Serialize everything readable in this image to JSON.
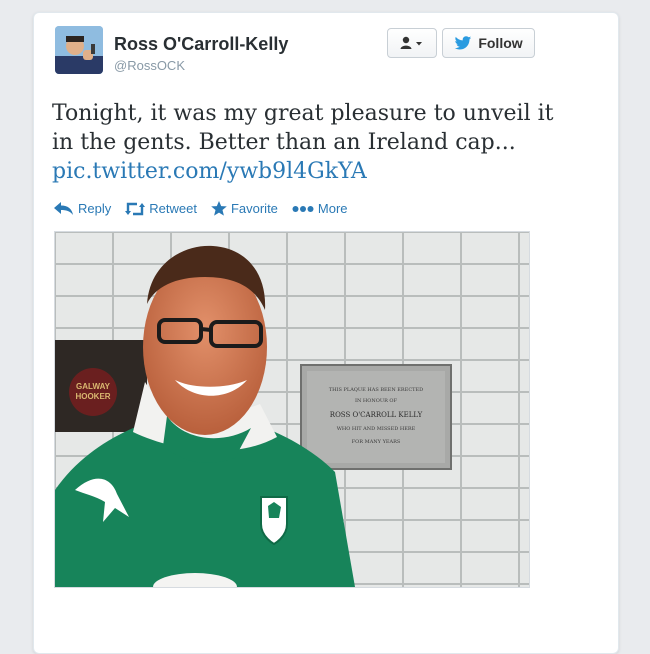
{
  "tweet": {
    "display_name": "Ross O'Carroll-Kelly",
    "handle": "@RossOCK",
    "text": "Tonight, it was my great pleasure to unveil it in the gents. Better than an Ireland cap...",
    "link": "pic.twitter.com/ywb9l4GkYA"
  },
  "buttons": {
    "follow_label": "Follow",
    "user_dropdown_icon": "user-icon"
  },
  "actions": [
    {
      "label": "Reply",
      "icon": "reply-icon"
    },
    {
      "label": "Retweet",
      "icon": "retweet-icon"
    },
    {
      "label": "Favorite",
      "icon": "star-icon"
    },
    {
      "label": "More",
      "icon": "more-dots-icon"
    }
  ],
  "photo": {
    "sign_text": [
      "GALWAY",
      "HOOKER"
    ],
    "plaque_lines": [
      "THIS PLAQUE HAS BEEN ERECTED",
      "IN HONOUR OF",
      "ROSS O'CARROLL KELLY",
      "WHO HIT AND MISSED HERE",
      "FOR MANY YEARS"
    ]
  },
  "colors": {
    "link": "#2a79b5",
    "jersey": "#17845a",
    "tile": "#e4e6e5",
    "plaque": "#a8a9a7"
  }
}
